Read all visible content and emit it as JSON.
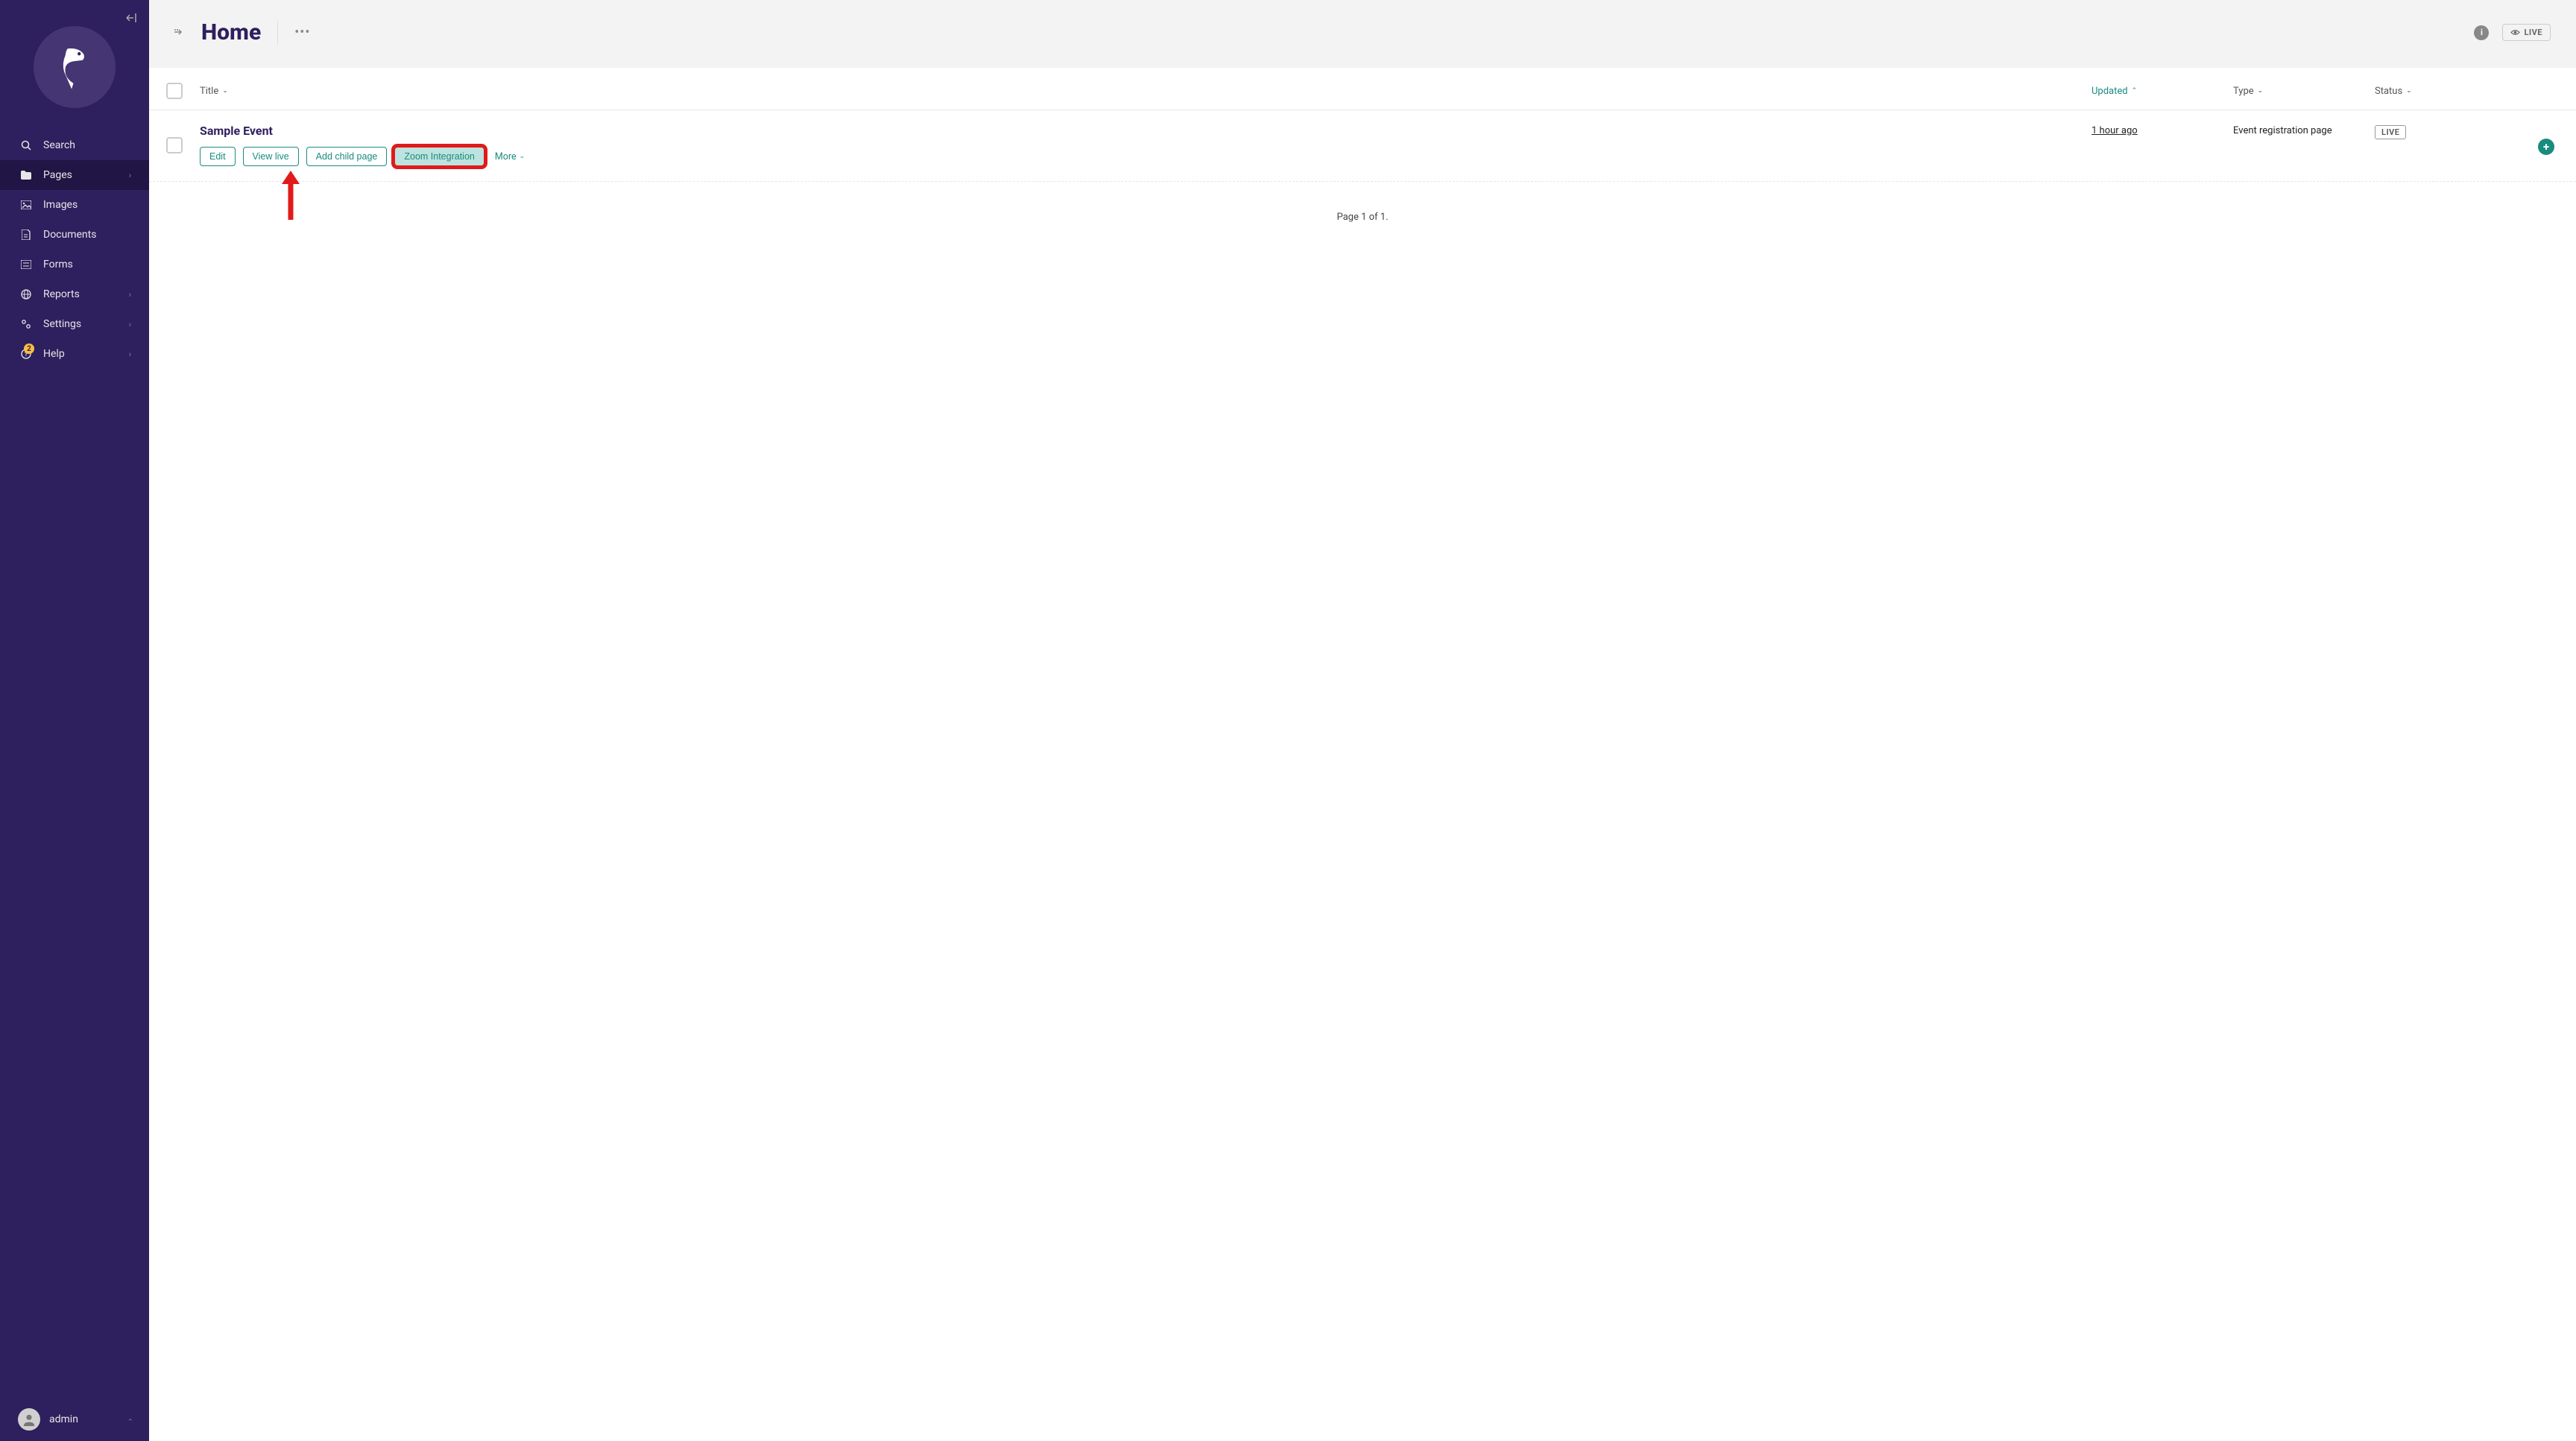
{
  "sidebar": {
    "items": [
      {
        "icon": "search",
        "label": "Search"
      },
      {
        "icon": "folder",
        "label": "Pages",
        "chevron": true,
        "active": true
      },
      {
        "icon": "image",
        "label": "Images"
      },
      {
        "icon": "document",
        "label": "Documents"
      },
      {
        "icon": "form",
        "label": "Forms"
      },
      {
        "icon": "globe",
        "label": "Reports",
        "chevron": true
      },
      {
        "icon": "cog",
        "label": "Settings",
        "chevron": true
      },
      {
        "icon": "help",
        "label": "Help",
        "chevron": true,
        "badge": "2"
      }
    ],
    "user": "admin"
  },
  "header": {
    "title": "Home",
    "live_label": "LIVE"
  },
  "table": {
    "columns": {
      "title": "Title",
      "updated": "Updated",
      "type": "Type",
      "status": "Status"
    },
    "row": {
      "title": "Sample Event",
      "updated": "1 hour ago",
      "type": "Event registration page",
      "status": "LIVE",
      "actions": {
        "edit": "Edit",
        "view_live": "View live",
        "add_child": "Add child page",
        "zoom": "Zoom Integration",
        "more": "More"
      }
    }
  },
  "pagination": "Page 1 of 1.",
  "colors": {
    "sidebar_bg": "#2e1f5e",
    "sidebar_active": "#201545",
    "accent_teal": "#1a8b7f",
    "title_purple": "#2e1f5e",
    "highlight_red": "#e11a1a"
  }
}
